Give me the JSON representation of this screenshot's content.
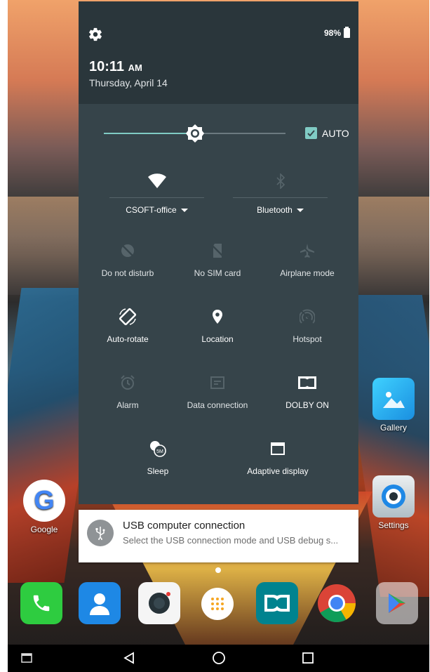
{
  "status": {
    "battery_percent": "98%",
    "time": "10:11",
    "ampm": "AM",
    "date": "Thursday, April 14"
  },
  "brightness": {
    "level": 0.5,
    "auto_label": "AUTO",
    "auto_checked": true
  },
  "big_tiles": [
    {
      "label": "CSOFT-office",
      "icon": "wifi-icon",
      "active": true
    },
    {
      "label": "Bluetooth",
      "icon": "bluetooth-icon",
      "active": false
    }
  ],
  "tiles": [
    {
      "label": "Do not disturb",
      "icon": "do-not-disturb-icon",
      "active": false
    },
    {
      "label": "No SIM card",
      "icon": "no-sim-icon",
      "active": false
    },
    {
      "label": "Airplane mode",
      "icon": "airplane-icon",
      "active": false
    },
    {
      "label": "Auto-rotate",
      "icon": "auto-rotate-icon",
      "active": true
    },
    {
      "label": "Location",
      "icon": "location-icon",
      "active": true
    },
    {
      "label": "Hotspot",
      "icon": "hotspot-icon",
      "active": false
    },
    {
      "label": "Alarm",
      "icon": "alarm-icon",
      "active": false
    },
    {
      "label": "Data connection",
      "icon": "data-connection-icon",
      "active": false
    },
    {
      "label": "DOLBY ON",
      "icon": "dolby-icon",
      "active": true
    },
    {
      "label": "Sleep",
      "icon": "sleep-icon",
      "active": true,
      "badge": "5M"
    },
    {
      "label": "Adaptive display",
      "icon": "adaptive-display-icon",
      "active": true
    }
  ],
  "notification": {
    "title": "USB computer connection",
    "text": "Select the USB connection mode and USB debug s...",
    "icon": "usb-icon"
  },
  "home_apps": [
    {
      "label": "Gallery"
    },
    {
      "label": "Google"
    },
    {
      "label": "Settings"
    }
  ],
  "dock": [
    "phone-icon",
    "contacts-icon",
    "camera-icon",
    "app-drawer-icon",
    "dolby-app-icon",
    "chrome-icon",
    "play-store-icon"
  ],
  "colors": {
    "header_bg": "#2a363b",
    "panel_bg": "#36444a",
    "accent": "#80cbc4"
  }
}
